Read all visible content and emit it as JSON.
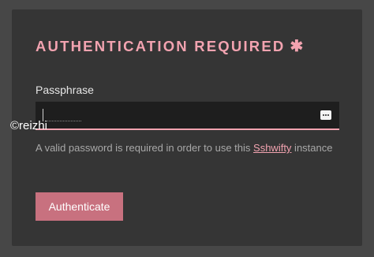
{
  "dialog": {
    "title": "AUTHENTICATION REQUIRED",
    "title_icon": "asterisk-icon",
    "title_symbol": "✱",
    "field_label": "Passphrase",
    "input_value": "",
    "input_placeholder": "",
    "password_toggle_icon": "password-dots-icon",
    "helper_prefix": "A valid password is required in order to use this ",
    "helper_link": "Sshwifty",
    "helper_suffix": " instance",
    "button_label": "Authenticate"
  },
  "watermark": "©reizhi",
  "colors": {
    "page_background": "#474747",
    "card_background": "#353535",
    "input_background": "#1e1e1e",
    "accent": "#f2a3b0",
    "button_background": "#c8717f",
    "helper_text": "#a8a8a8"
  }
}
